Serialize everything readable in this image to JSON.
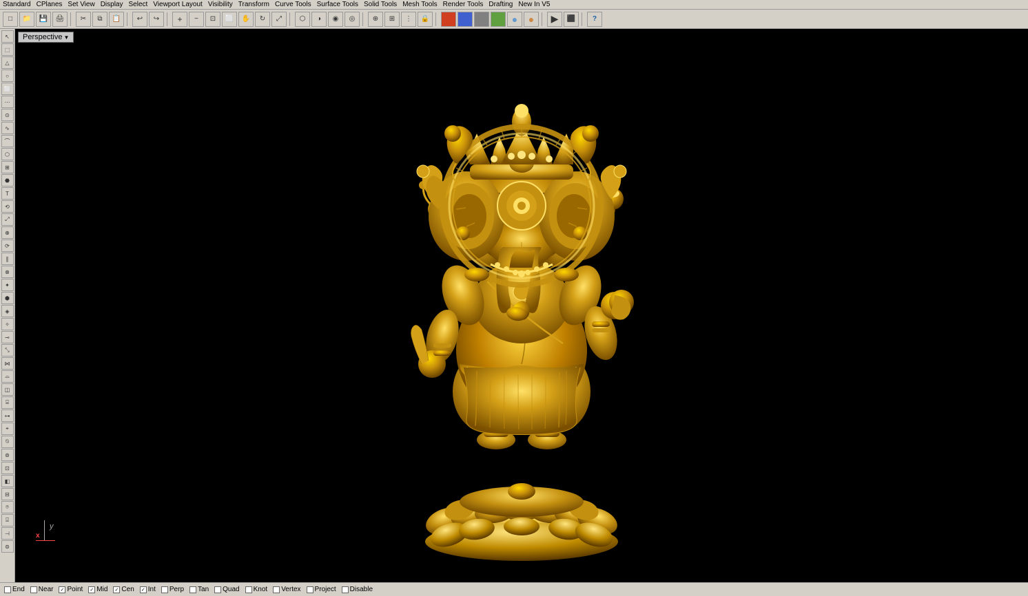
{
  "menubar": {
    "items": [
      "Standard",
      "CPlanes",
      "Set View",
      "Display",
      "Select",
      "Viewport Layout",
      "Visibility",
      "Transform",
      "Curve Tools",
      "Surface Tools",
      "Solid Tools",
      "Mesh Tools",
      "Render Tools",
      "Drafting",
      "New In V5"
    ]
  },
  "toolbar": {
    "buttons": [
      {
        "name": "new",
        "icon": "□"
      },
      {
        "name": "open",
        "icon": "📂"
      },
      {
        "name": "save",
        "icon": "💾"
      },
      {
        "name": "print",
        "icon": "🖨"
      },
      {
        "name": "sep1",
        "icon": ""
      },
      {
        "name": "select",
        "icon": "↖"
      },
      {
        "name": "copy",
        "icon": "⧉"
      },
      {
        "name": "paste",
        "icon": "📋"
      },
      {
        "name": "undo",
        "icon": "↩"
      },
      {
        "name": "zoom-in",
        "icon": "+"
      },
      {
        "name": "zoom-out",
        "icon": "-"
      },
      {
        "name": "zoom-fit",
        "icon": "⊡"
      },
      {
        "name": "zoom-window",
        "icon": "⬜"
      },
      {
        "name": "pan",
        "icon": "✋"
      },
      {
        "name": "rotate3d",
        "icon": "↻"
      },
      {
        "name": "extents",
        "icon": "⤢"
      },
      {
        "name": "wireframe",
        "icon": "⬡"
      },
      {
        "name": "sep2",
        "icon": ""
      },
      {
        "name": "snap",
        "icon": "⊕"
      },
      {
        "name": "ortho",
        "icon": "⊞"
      },
      {
        "name": "grid",
        "icon": "⋮"
      },
      {
        "name": "snap2",
        "icon": "◎"
      },
      {
        "name": "lock",
        "icon": "🔒"
      },
      {
        "name": "sep3",
        "icon": ""
      },
      {
        "name": "color1",
        "icon": "●"
      },
      {
        "name": "color2",
        "icon": "●"
      },
      {
        "name": "color3",
        "icon": "●"
      },
      {
        "name": "color4",
        "icon": "●"
      },
      {
        "name": "color5",
        "icon": "●"
      },
      {
        "name": "color6",
        "icon": "●"
      },
      {
        "name": "sep4",
        "icon": ""
      },
      {
        "name": "render",
        "icon": "▶"
      },
      {
        "name": "help",
        "icon": "?"
      }
    ]
  },
  "viewport": {
    "label": "Perspective",
    "background": "#000000",
    "model_color": "#D4A017"
  },
  "status_bar": {
    "items": [
      {
        "label": "End",
        "checked": false
      },
      {
        "label": "Near",
        "checked": false
      },
      {
        "label": "Point",
        "checked": true
      },
      {
        "label": "Mid",
        "checked": true
      },
      {
        "label": "Cen",
        "checked": true
      },
      {
        "label": "Int",
        "checked": true
      },
      {
        "label": "Perp",
        "checked": false
      },
      {
        "label": "Tan",
        "checked": false
      },
      {
        "label": "Quad",
        "checked": false
      },
      {
        "label": "Knot",
        "checked": false
      },
      {
        "label": "Vertex",
        "checked": false
      },
      {
        "label": "Project",
        "checked": false
      },
      {
        "label": "Disable",
        "checked": false
      }
    ]
  }
}
